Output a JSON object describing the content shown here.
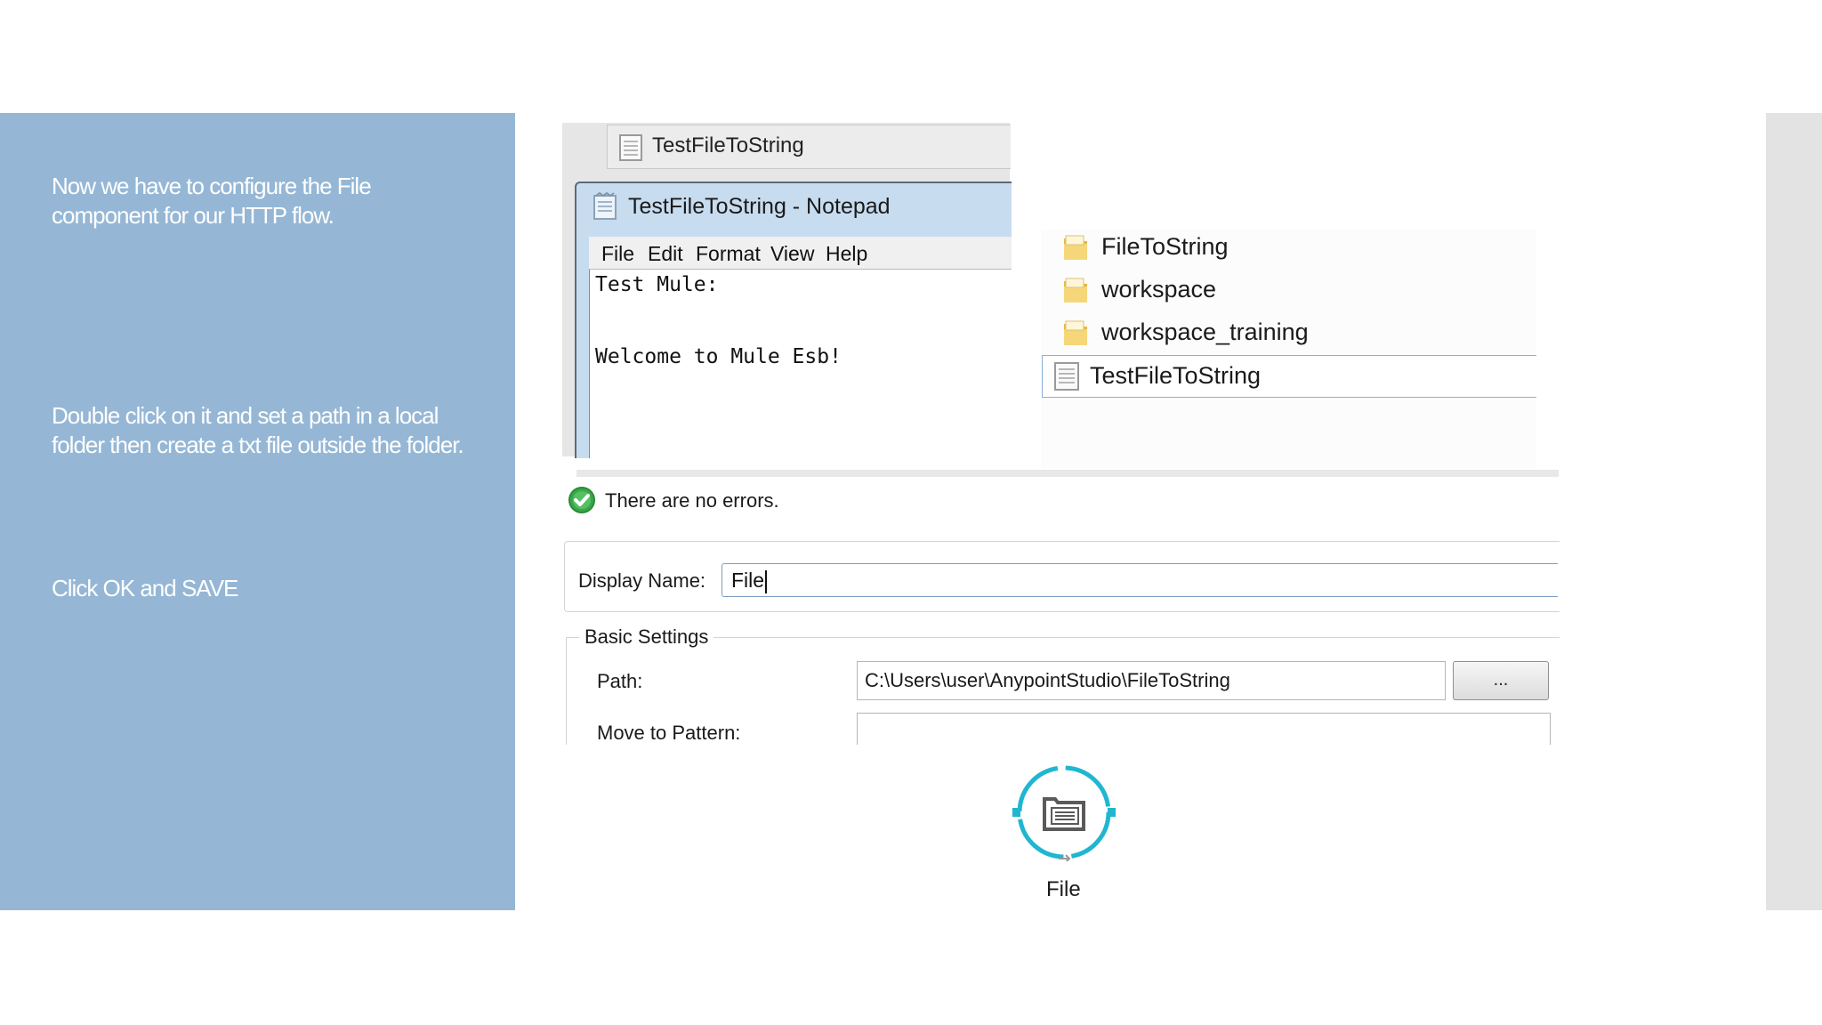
{
  "instructions": {
    "step1": "Now we have to configure  the File component for our HTTP flow.",
    "step2": "Double click on it and set a path in a local folder then create a txt file outside the folder.",
    "step3": "Click OK and SAVE"
  },
  "notepad": {
    "taskbar_tab": "TestFileToString",
    "window_title": "TestFileToString - Notepad",
    "menu": [
      "File",
      "Edit",
      "Format",
      "View",
      "Help"
    ],
    "lines": [
      "Test Mule:",
      "",
      "Welcome to Mule Esb!"
    ]
  },
  "explorer": {
    "items": [
      {
        "label": "FileToString",
        "icon": "folder-icon"
      },
      {
        "label": "workspace",
        "icon": "folder-icon"
      },
      {
        "label": "workspace_training",
        "icon": "folder-icon"
      },
      {
        "label": "TestFileToString",
        "icon": "text-file-icon",
        "selected": true
      }
    ]
  },
  "properties": {
    "status": "There are no errors.",
    "display_name_label": "Display Name:",
    "display_name_value": "File",
    "basic_settings_label": "Basic Settings",
    "path_label": "Path:",
    "path_value": "C:\\Users\\user\\AnypointStudio\\FileToString",
    "browse_label": "...",
    "move_to_pattern_label": "Move to Pattern:",
    "move_to_pattern_value": ""
  },
  "component": {
    "label": "File",
    "icon": "file-connector-icon"
  },
  "colors": {
    "panel_blue": "#95b7d5",
    "component_accent": "#1fb6d0",
    "ok_green": "#3aa84a"
  }
}
